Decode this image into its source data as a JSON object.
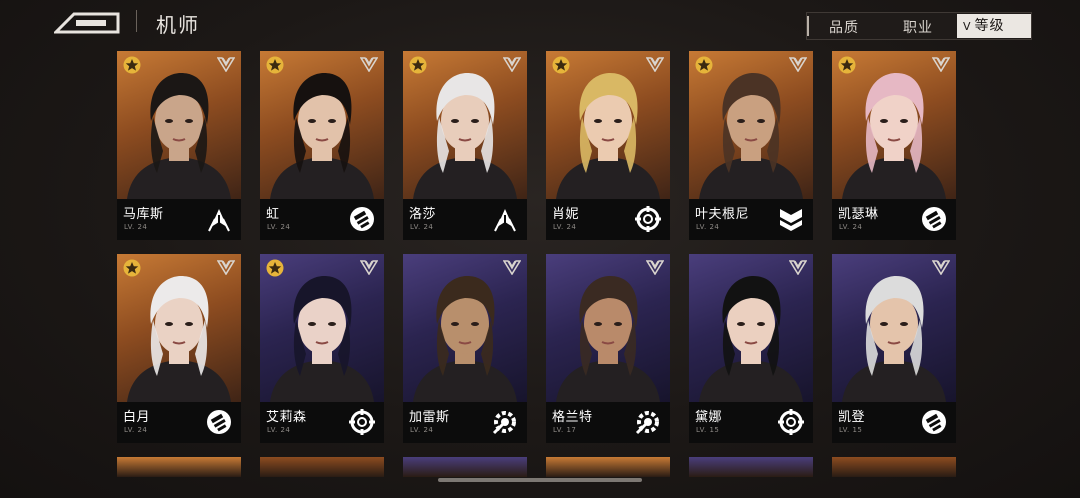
{
  "header": {
    "title": "机师"
  },
  "filters": {
    "quality": "品质",
    "class": "职业",
    "level": "等级"
  },
  "colors": {
    "orange_card": "#c77a35",
    "purple_card": "#4a3e7c",
    "accent_white": "#ebe7e2"
  },
  "pilots": [
    {
      "name": "马库斯",
      "level": "LV. 24",
      "frame": "orange",
      "gold_star": true,
      "class_icon": "arrow-burst-icon",
      "hair": "#1b1715",
      "skin": "#c9a58a"
    },
    {
      "name": "虹",
      "level": "LV. 24",
      "frame": "orange",
      "gold_star": true,
      "class_icon": "fist-icon",
      "hair": "#16110f",
      "skin": "#e2c2aa"
    },
    {
      "name": "洛莎",
      "level": "LV. 24",
      "frame": "orange",
      "gold_star": true,
      "class_icon": "arrow-burst-icon",
      "hair": "#e8e6e6",
      "skin": "#e8cdbb"
    },
    {
      "name": "肖妮",
      "level": "LV. 24",
      "frame": "orange",
      "gold_star": true,
      "class_icon": "crosshair-icon",
      "hair": "#d9b864",
      "skin": "#ebcbb0"
    },
    {
      "name": "叶夫根尼",
      "level": "LV. 24",
      "frame": "orange",
      "gold_star": true,
      "class_icon": "shield-chevron-icon",
      "hair": "#4b3325",
      "skin": "#c9a080"
    },
    {
      "name": "凯瑟琳",
      "level": "LV. 24",
      "frame": "orange",
      "gold_star": true,
      "class_icon": "fist-icon",
      "hair": "#e6b8c4",
      "skin": "#f0d2c8"
    },
    {
      "name": "白月",
      "level": "LV. 24",
      "frame": "orange",
      "gold_star": true,
      "class_icon": "fist-icon",
      "hair": "#eceaea",
      "skin": "#ead2c4"
    },
    {
      "name": "艾莉森",
      "level": "LV. 24",
      "frame": "purple",
      "gold_star": true,
      "class_icon": "crosshair-icon",
      "hair": "#17152a",
      "skin": "#ead2c8"
    },
    {
      "name": "加雷斯",
      "level": "LV. 24",
      "frame": "purple",
      "gold_star": false,
      "class_icon": "gear-wrench-icon",
      "hair": "#3b2a1d",
      "skin": "#b88f6c"
    },
    {
      "name": "格兰特",
      "level": "LV. 17",
      "frame": "purple",
      "gold_star": false,
      "class_icon": "gear-wrench-icon",
      "hair": "#3a2a22",
      "skin": "#b98a6a"
    },
    {
      "name": "黛娜",
      "level": "LV. 15",
      "frame": "purple",
      "gold_star": false,
      "class_icon": "crosshair-icon",
      "hair": "#121212",
      "skin": "#ebd0c0"
    },
    {
      "name": "凯登",
      "level": "LV. 15",
      "frame": "purple",
      "gold_star": false,
      "class_icon": "fist-icon",
      "hair": "#dcdcdc",
      "skin": "#e4c4ab"
    }
  ]
}
